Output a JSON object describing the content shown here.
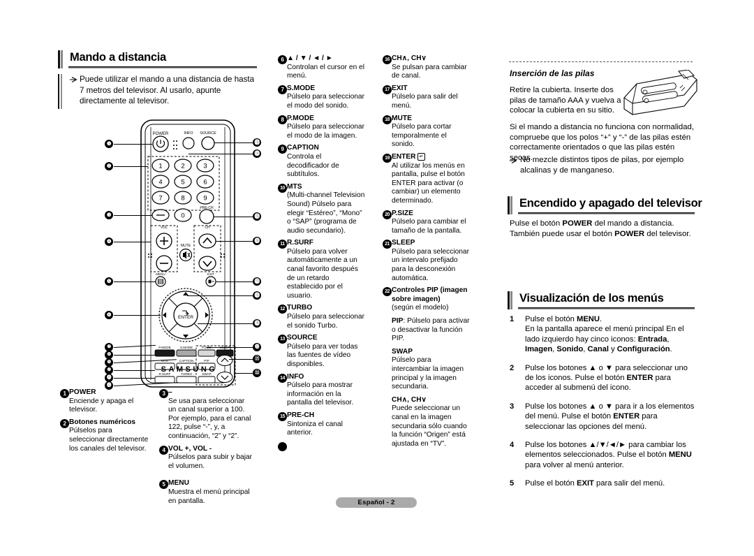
{
  "page": {
    "footer_label": "Español - 2"
  },
  "remote_section": {
    "title": "Mando a distancia",
    "intro": "Puede utilizar el mando a una distancia de hasta 7 metros del televisor. Al usarlo, apunte directamente al televisor.",
    "brand": "SAMSUNG",
    "button_labels": {
      "power": "POWER",
      "info": "INFO",
      "source": "SOURCE",
      "prech": "PRE-CH",
      "vol": "VOL",
      "ch": "CH",
      "mute": "MUTE",
      "menu": "MENU",
      "exit": "EXIT",
      "enter": "ENTER",
      "pmode": "P.MODE",
      "smode": "S.MODE",
      "psize": "P.SIZE",
      "sleep": "SLEEP",
      "mts": "MTS",
      "caption": "CAPTION",
      "rsurf": "R.SURF",
      "turbo": "TURBO",
      "pip": "PIP",
      "swap": "SWAP",
      "keys": [
        "1",
        "2",
        "3",
        "4",
        "5",
        "6",
        "7",
        "8",
        "9",
        "0"
      ],
      "dash": "–"
    }
  },
  "legend": {
    "col1": [
      {
        "n": "1",
        "title": "POWER",
        "desc": "Enciende y apaga el televisor."
      },
      {
        "n": "2",
        "title": "Botones numéricos",
        "desc": "Púlselos para seleccionar directamente los canales del televisor."
      }
    ],
    "col2": [
      {
        "n": "3",
        "title": "–",
        "desc": "Se usa para seleccionar un canal superior a 100. Por ejemplo, para el canal 122, pulse “-”, y, a continuación, “2” y “2”."
      },
      {
        "n": "4",
        "title": "VOL +, VOL -",
        "desc": "Púlselos para subir y bajar el volumen."
      },
      {
        "n": "5",
        "title": "MENU",
        "desc": "Muestra el menú principal en pantalla."
      }
    ],
    "col3": [
      {
        "n": "6",
        "title": "▲ / ▼ / ◄ / ►",
        "desc": "Controlan el cursor en el menú."
      },
      {
        "n": "7",
        "title": "S.MODE",
        "desc": "Púlselo para seleccionar el modo del sonido."
      },
      {
        "n": "8",
        "title": "P.MODE",
        "desc": "Púlselo para seleccionar el modo de la imagen."
      },
      {
        "n": "9",
        "title": "CAPTION",
        "desc": "Controla el decodificador de subtítulos."
      },
      {
        "n": "10",
        "title": "MTS",
        "desc": "(Multi-channel Television Sound) Púlselo para elegir “Estéreo”, “Mono” o “SAP” (programa de audio secundario)."
      },
      {
        "n": "11",
        "title": "R.SURF",
        "desc": "Púlselo para volver automáticamente a un canal favorito después de un retardo establecido por el usuario."
      },
      {
        "n": "12",
        "title": "TURBO",
        "desc": "Púlselo para seleccionar el sonido Turbo."
      },
      {
        "n": "13",
        "title": "SOURCE",
        "desc": "Púlselo para ver todas las fuentes de vídeo disponibles."
      },
      {
        "n": "14",
        "title": "INFO",
        "desc": "Púlselo para mostrar información en la pantalla del televisor."
      },
      {
        "n": "15",
        "title": "PRE-CH",
        "desc": "Sintoniza el canal anterior."
      }
    ],
    "col4": [
      {
        "n": "16",
        "title": "CH∧, CH∨",
        "desc": "Se pulsan para cambiar de canal."
      },
      {
        "n": "17",
        "title": "EXIT",
        "desc": "Púlselo para salir del menú."
      },
      {
        "n": "18",
        "title": "MUTE",
        "desc": "Púlselo para cortar temporalmente el sonido."
      },
      {
        "n": "19",
        "title": "ENTER",
        "desc": "Al utilizar los menús en pantalla, pulse el botón ENTER para activar (o cambiar) un elemento determinado."
      },
      {
        "n": "20",
        "title": "P.SIZE",
        "desc": "Púlselo para cambiar el tamaño de la pantalla."
      },
      {
        "n": "21",
        "title": "SLEEP",
        "desc": "Púlselo para seleccionar un intervalo prefijado para la desconexión automática."
      },
      {
        "n": "22",
        "title": "Controles PIP (imagen sobre imagen)",
        "desc": "(según el modelo)",
        "sub": [
          {
            "label": "PIP",
            "suffix": ": Púlselo para activar o desactivar la función PIP."
          },
          {
            "label": "SWAP",
            "suffix": "",
            "desc": "Púlselo para intercambiar la imagen principal y la imagen secundaria."
          },
          {
            "label": "CH∧, CH∨",
            "suffix": "",
            "desc": "Puede seleccionar un canal en la imagen secundaria sólo cuando la función “Origen” está ajustada en “TV”."
          }
        ]
      }
    ]
  },
  "batteries": {
    "title": "Inserción de las pilas",
    "p1": "Retire la cubierta. Inserte dos pilas de tamaño AAA y vuelva a colocar la cubierta en su sitio.",
    "p2": "Si el mando a distancia no funciona con normalidad, compruebe que los polos “+” y “-” de las pilas estén correctamente orientados o que las pilas estén secas.",
    "bullet": "No mezcle distintos tipos de pilas, por ejemplo alcalinas y de manganeso."
  },
  "power_section": {
    "title": "Encendido y apagado del televisor",
    "line1_a": "Pulse el botón ",
    "line1_b": "POWER",
    "line1_c": " del mando a distancia.",
    "line2_a": "También puede usar el botón ",
    "line2_b": "POWER",
    "line2_c": " del televisor."
  },
  "menu_section": {
    "title": "Visualización de los menús",
    "steps": [
      {
        "n": "1",
        "html": "Pulse el botón <b>MENU</b>.<br>En la pantalla aparece el menú principal En el lado izquierdo hay cinco iconos: <b>Entrada</b>, <b>Imagen</b>, <b>Sonido</b>, <b>Canal</b> y <b>Configuración</b>."
      },
      {
        "n": "2",
        "html": "Pulse los botones ▲ o ▼ para seleccionar uno de los iconos. Pulse el botón <b>ENTER</b> para acceder al submenú del icono."
      },
      {
        "n": "3",
        "html": "Pulse los botones ▲ o ▼ para ir a los elementos del menú. Pulse el botón <b>ENTER</b> para seleccionar las opciones del menú."
      },
      {
        "n": "4",
        "html": "Pulse los botones ▲/▼/◄/► para cambiar los elementos seleccionados. Pulse el botón <b>MENU</b> para volver al menú anterior."
      },
      {
        "n": "5",
        "html": "Pulse el botón <b>EXIT</b> para salir del menú."
      }
    ]
  }
}
